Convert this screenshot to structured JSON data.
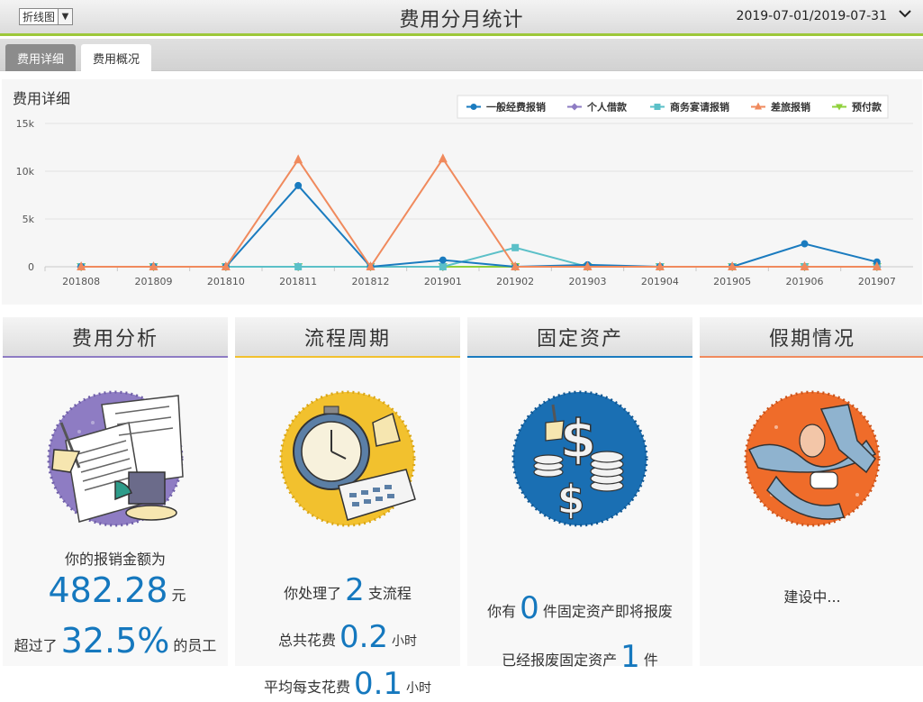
{
  "header": {
    "chart_type_select": "折线图",
    "title": "费用分月统计",
    "date_range": "2019-07-01/2019-07-31"
  },
  "tabs": [
    {
      "label": "费用详细",
      "active": true
    },
    {
      "label": "费用概况",
      "active": false
    }
  ],
  "chart_panel": {
    "title": "费用详细"
  },
  "chart_data": {
    "type": "line",
    "categories": [
      "201808",
      "201809",
      "201810",
      "201811",
      "201812",
      "201901",
      "201902",
      "201903",
      "201904",
      "201905",
      "201906",
      "201907"
    ],
    "ylim": [
      0,
      15000
    ],
    "ytick_labels": [
      "0",
      "5k",
      "10k",
      "15k"
    ],
    "ytick_values": [
      0,
      5000,
      10000,
      15000
    ],
    "grid": true,
    "legend_position": "top-right",
    "series": [
      {
        "name": "一般经费报销",
        "color": "#1a7bbf",
        "marker": "circle",
        "values": [
          0,
          0,
          0,
          8500,
          0,
          700,
          0,
          200,
          0,
          0,
          2400,
          500
        ]
      },
      {
        "name": "个人借款",
        "color": "#8e7cc3",
        "marker": "diamond",
        "values": [
          0,
          0,
          0,
          0,
          0,
          0,
          0,
          0,
          0,
          0,
          0,
          0
        ]
      },
      {
        "name": "商务宴请报销",
        "color": "#5bc0c8",
        "marker": "square",
        "values": [
          0,
          0,
          0,
          0,
          0,
          0,
          2000,
          0,
          0,
          0,
          0,
          0
        ]
      },
      {
        "name": "差旅报销",
        "color": "#f08a5d",
        "marker": "triangle",
        "values": [
          0,
          0,
          0,
          11200,
          0,
          11300,
          0,
          0,
          0,
          0,
          0,
          0
        ]
      },
      {
        "name": "预付款",
        "color": "#8fd13b",
        "marker": "tri-down",
        "values": [
          0,
          0,
          0,
          0,
          0,
          0,
          0,
          0,
          0,
          0,
          0,
          0
        ]
      }
    ]
  },
  "cards": {
    "expense": {
      "title": "费用分析",
      "accent": "#8e7cc3",
      "line1": "你的报销金额为",
      "amount": "482.28",
      "amount_unit": "元",
      "exceed_prefix": "超过了",
      "percent": "32.5%",
      "exceed_suffix": "的员工",
      "icon": "documents-chart-icon"
    },
    "process": {
      "title": "流程周期",
      "accent": "#f2c12e",
      "handled_prefix": "你处理了",
      "handled_count": "2",
      "handled_suffix": "支流程",
      "total_prefix": "总共花费",
      "total_hours": "0.2",
      "total_unit": "小时",
      "avg_prefix": "平均每支花费",
      "avg_hours": "0.1",
      "avg_unit": "小时",
      "icon": "clock-calculator-icon"
    },
    "assets": {
      "title": "固定资产",
      "accent": "#1a7bbf",
      "have_prefix": "你有",
      "scrap_soon_count": "0",
      "have_suffix": "件固定资产即将报废",
      "scrapped_prefix": "已经报废固定资产",
      "scrapped_count": "1",
      "scrapped_unit": "件",
      "icon": "dollar-coins-icon"
    },
    "holiday": {
      "title": "假期情况",
      "accent": "#f08a5d",
      "status": "建设中...",
      "icon": "beach-chair-icon"
    }
  }
}
